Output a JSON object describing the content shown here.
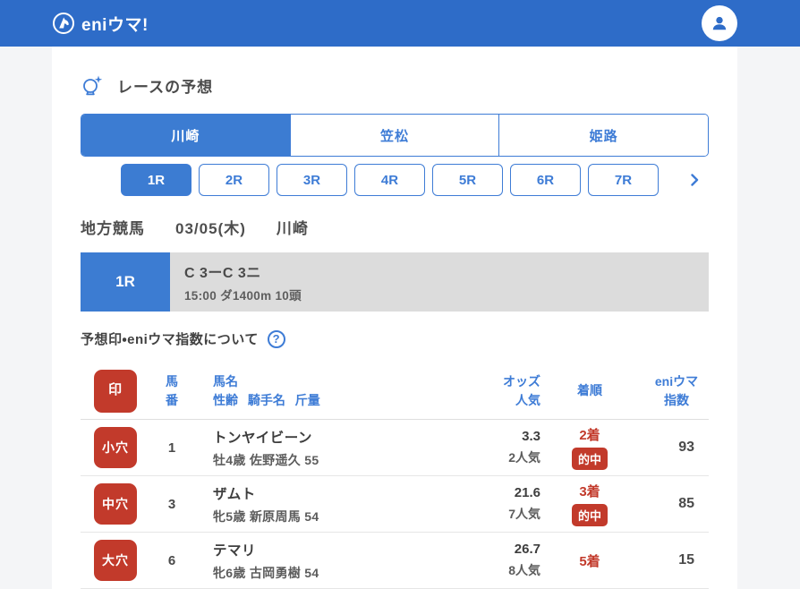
{
  "colors": {
    "navbar_blue": "#2E6CC8",
    "primary_blue": "#3C7CD2",
    "link_blue": "#3E7CD6",
    "badge_red": "#C23A2B",
    "banner_gray": "#DCDCDC"
  },
  "navbar": {
    "logo_text": "eniウマ!"
  },
  "page": {
    "section_title": "レースの予想",
    "venue_tabs": [
      {
        "label": "川崎",
        "selected": true
      },
      {
        "label": "笠松",
        "selected": false
      },
      {
        "label": "姫路",
        "selected": false
      }
    ],
    "race_tabs": [
      {
        "label": "1R",
        "selected": true
      },
      {
        "label": "2R",
        "selected": false
      },
      {
        "label": "3R",
        "selected": false
      },
      {
        "label": "4R",
        "selected": false
      },
      {
        "label": "5R",
        "selected": false
      },
      {
        "label": "6R",
        "selected": false
      },
      {
        "label": "7R",
        "selected": false
      }
    ],
    "meta": {
      "category": "地方競馬",
      "date": "03/05(木)",
      "venue": "川崎"
    },
    "race_info": {
      "race_no": "1R",
      "title": "C 3ーC 3ニ",
      "subtitle": "15:00 ダ1400m 10頭"
    },
    "about": {
      "label": "予想印・eniウマ指数について",
      "help_glyph": "?"
    },
    "table": {
      "headers": {
        "mark": "印",
        "number_line1": "馬",
        "number_line2": "番",
        "name_line1": "馬名",
        "name_line2": "性齢 騎手名 斤量",
        "odds_line1": "オッズ",
        "odds_line2": "人気",
        "rank": "着順",
        "index_line1": "eniウマ",
        "index_line2": "指数"
      },
      "rows": [
        {
          "mark": "小穴",
          "number": "1",
          "name": "トンヤイビーン",
          "detail": "牡4歳 佐野遥久 55",
          "odds": "3.3",
          "popularity": "2人気",
          "rank": "2着",
          "hit": "的中",
          "index": "93"
        },
        {
          "mark": "中穴",
          "number": "3",
          "name": "ザムト",
          "detail": "牝5歳 新原周馬 54",
          "odds": "21.6",
          "popularity": "7人気",
          "rank": "3着",
          "hit": "的中",
          "index": "85"
        },
        {
          "mark": "大穴",
          "number": "6",
          "name": "テマリ",
          "detail": "牝6歳 古岡勇樹 54",
          "odds": "26.7",
          "popularity": "8人気",
          "rank": "5着",
          "hit": "",
          "index": "15"
        }
      ]
    }
  }
}
